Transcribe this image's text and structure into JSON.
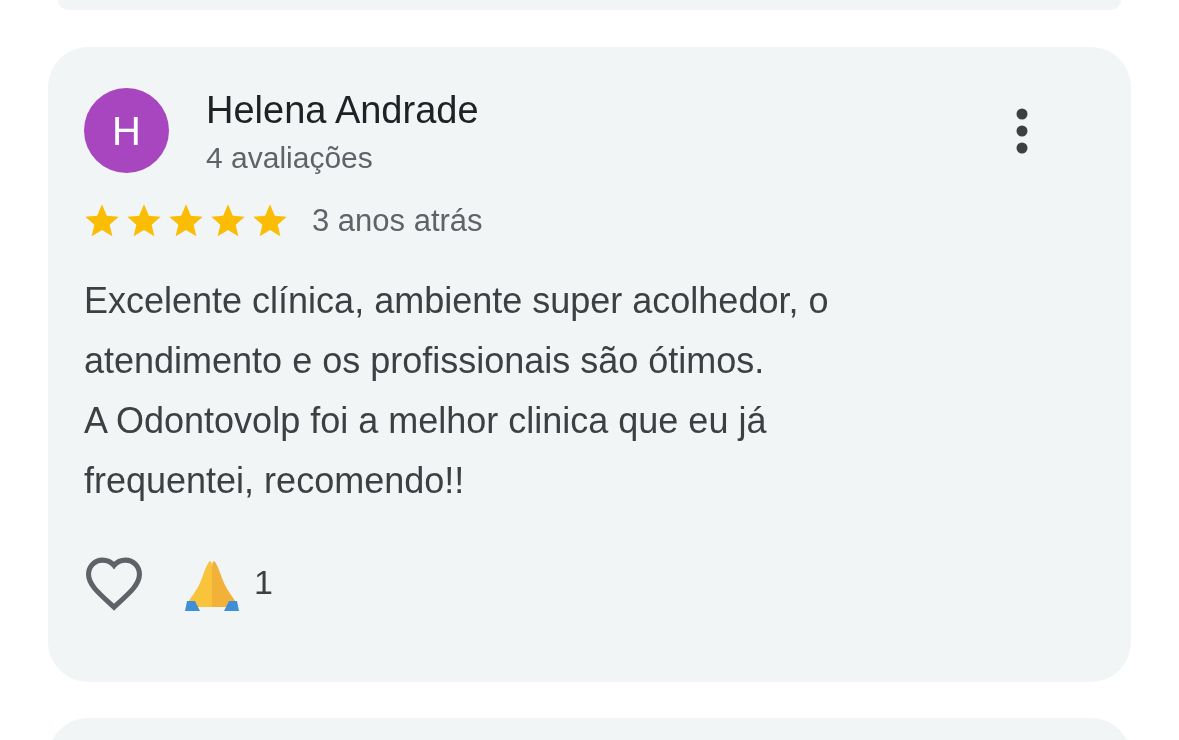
{
  "review": {
    "author": {
      "initial": "H",
      "name": "Helena Andrade",
      "review_count": "4 avaliações"
    },
    "stars": 5,
    "time": "3 anos atrás",
    "text": [
      "Excelente clínica, ambiente super acolhedor, o",
      "atendimento e os profissionais são ótimos.",
      "A Odontovolp foi a melhor clinica que eu já",
      "frequentei, recomendo!!"
    ],
    "liked": false,
    "reactions": [
      {
        "count": "1"
      }
    ]
  }
}
